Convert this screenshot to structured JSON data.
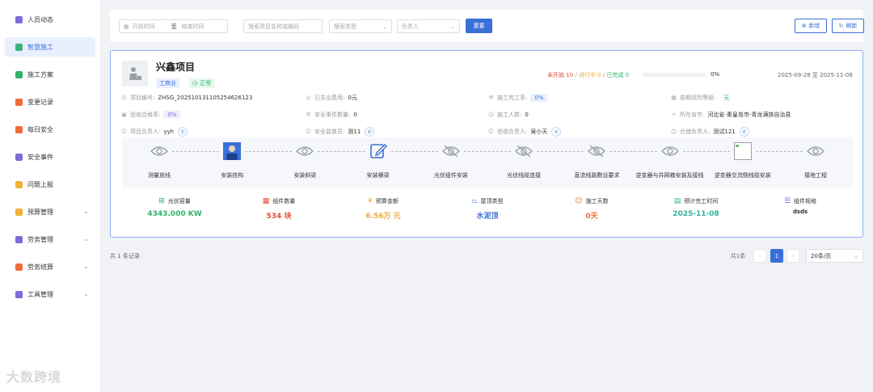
{
  "sidebar": {
    "items": [
      {
        "label": "人员动态",
        "icon": "people-icon",
        "color": "#7b6cd9",
        "active": false,
        "chevron": false
      },
      {
        "label": "智慧施工",
        "icon": "construction-icon",
        "color": "#3bb37a",
        "active": true,
        "chevron": false
      },
      {
        "label": "施工方案",
        "icon": "grid-icon",
        "color": "#2fb36b",
        "active": false,
        "chevron": false
      },
      {
        "label": "变更记录",
        "icon": "record-icon",
        "color": "#f06b3a",
        "active": false,
        "chevron": false
      },
      {
        "label": "每日安全",
        "icon": "shield-icon",
        "color": "#f06b3a",
        "active": false,
        "chevron": false
      },
      {
        "label": "安全事件",
        "icon": "alert-icon",
        "color": "#7b6cd9",
        "active": false,
        "chevron": false
      },
      {
        "label": "问题上报",
        "icon": "report-icon",
        "color": "#f0b23a",
        "active": false,
        "chevron": false
      },
      {
        "label": "预算管理",
        "icon": "budget-icon",
        "color": "#f0b23a",
        "active": false,
        "chevron": true
      },
      {
        "label": "劳务管理",
        "icon": "labor-icon",
        "color": "#7b6cd9",
        "active": false,
        "chevron": true
      },
      {
        "label": "劳务结算",
        "icon": "settle-icon",
        "color": "#f06b3a",
        "active": false,
        "chevron": true
      },
      {
        "label": "工具管理",
        "icon": "tool-icon",
        "color": "#7b6cd9",
        "active": false,
        "chevron": true
      }
    ],
    "watermark": "大数跨境"
  },
  "toolbar": {
    "start_placeholder": "开始时间",
    "range_sep": "至",
    "end_placeholder": "结束时间",
    "search_placeholder": "搜索项目名称或编码",
    "type_placeholder": "搜索类型",
    "owner_placeholder": "负责人",
    "reset_label": "重置",
    "add_label": "新增",
    "refresh_label": "刷新"
  },
  "project": {
    "name": "兴鑫项目",
    "tag_type": "工商业",
    "tag_status": "正常",
    "not_started": "未开始 10",
    "in_progress": "进行中 0",
    "completed": "已完成 0",
    "progress_pct": "0%",
    "progress_value": 0,
    "date_range": "2025-09-28 至 2025-11-08",
    "info": {
      "code_label": "项目编号:",
      "code": "ZHSG_20251013110525462612​3",
      "spent_label": "已支出费用:",
      "spent": "0元",
      "completion_label": "施工完工率:",
      "completion": "0%",
      "risk_label": "逾期风险等级:",
      "risk": "无",
      "accept_label": "验收合格率:",
      "accept": "0%",
      "events_label": "安全事件数量:",
      "events": "0",
      "workers_label": "施工人数:",
      "workers": "0",
      "province_label": "所在省市:",
      "province": "河北省-秦皇岛市-青龙满族自治县",
      "owner_label": "项目负责人:",
      "owner": "yyh",
      "safety_label": "安全监督员:",
      "safety": "测11",
      "acceptor_label": "验收负责人:",
      "acceptor": "吴小天",
      "warehouse_label": "仓储负责人:",
      "warehouse": "测试121"
    },
    "steps": [
      {
        "label": "测量放线",
        "icon": "eye-icon"
      },
      {
        "label": "安装挂构",
        "icon": "worker-photo-icon"
      },
      {
        "label": "安装斜梁",
        "icon": "eye-icon"
      },
      {
        "label": "安装横梁",
        "icon": "edit-icon"
      },
      {
        "label": "光伏组件安装",
        "icon": "eye-off-icon"
      },
      {
        "label": "光伏线缆连接",
        "icon": "eye-off-icon"
      },
      {
        "label": "直流线路敷设要求",
        "icon": "eye-off-icon"
      },
      {
        "label": "逆变器与并网箱安装及接线",
        "icon": "eye-icon"
      },
      {
        "label": "逆变器交流侧线缆安装",
        "icon": "broken-image-icon"
      },
      {
        "label": "接地工程",
        "icon": "eye-icon"
      }
    ],
    "stats": [
      {
        "label": "光伏容量",
        "value": "4343.000 KW",
        "color": "#2fb36b",
        "icon": "capacity-icon"
      },
      {
        "label": "组件数量",
        "value": "534 块",
        "color": "#e84a3a",
        "icon": "module-icon"
      },
      {
        "label": "预算金额",
        "value": "6.56万 元",
        "color": "#f0a83a",
        "icon": "money-icon"
      },
      {
        "label": "屋顶类型",
        "value": "水泥顶",
        "color": "#3a6fd8",
        "icon": "roof-icon"
      },
      {
        "label": "施工天数",
        "value": "0天",
        "color": "#f06b3a",
        "icon": "days-icon"
      },
      {
        "label": "预计完工时间",
        "value": "2025-11-08",
        "color": "#2fb3a0",
        "icon": "calendar-icon"
      },
      {
        "label": "组件规格",
        "value": "dsds",
        "color": "#333333",
        "icon": "spec-icon"
      }
    ]
  },
  "footer": {
    "record_count": "共 1 条记录",
    "total_text": "共1条",
    "current_page": "1",
    "page_size": "20条/页"
  }
}
